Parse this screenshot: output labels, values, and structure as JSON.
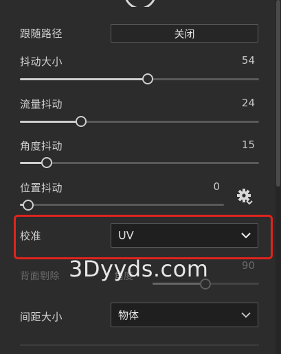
{
  "follow_path": {
    "label": "跟随路径",
    "value": "关闭"
  },
  "jitter_size": {
    "label": "抖动大小",
    "value": "54",
    "level": 0.54
  },
  "flow_jitter": {
    "label": "流量抖动",
    "value": "24",
    "level": 0.24
  },
  "angle_jitter": {
    "label": "角度抖动",
    "value": "15",
    "level": 0.15
  },
  "position_jitter": {
    "label": "位置抖动",
    "value": "0",
    "level": 0.0,
    "settings_icon": "gear-icon"
  },
  "calibration": {
    "label": "校准",
    "value": "UV"
  },
  "backface_cull": {
    "label": "背面剔除",
    "obscured_label": "角度",
    "value": "90",
    "level": 0.5
  },
  "spacing_size": {
    "label": "间距大小",
    "value": "物体"
  },
  "watermark": "3Dyyds.com",
  "colors": {
    "highlight": "#e0241e",
    "background": "#2c2c2c"
  }
}
